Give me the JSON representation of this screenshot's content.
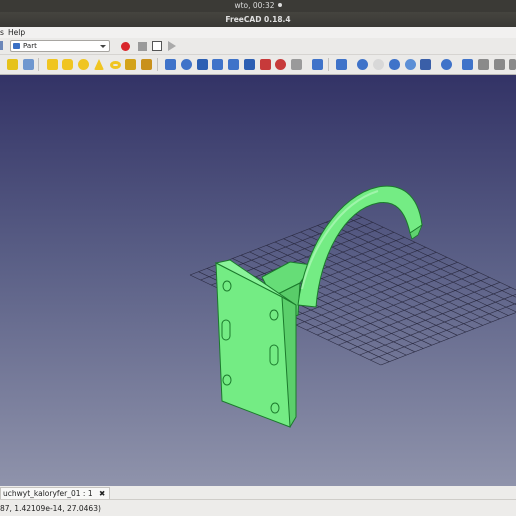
{
  "system_bar": {
    "clock": "wto, 00:32"
  },
  "window": {
    "title": "FreeCAD 0.18.4"
  },
  "menu": {
    "items": [
      "s",
      "Help"
    ]
  },
  "toolbar": {
    "workbench": "Part"
  },
  "document_tab": {
    "label": "uchwyt_kaloryfer_01 : 1",
    "close_glyph": "✖"
  },
  "status": {
    "coordinates": "87, 1.42109e-14, 27.0463)"
  },
  "colors": {
    "part_fill": "#74ec84",
    "part_edge": "#1b7a2c",
    "grid": "#2a2a40",
    "viewport_top": "#333366",
    "viewport_bottom": "#8f93ab"
  }
}
